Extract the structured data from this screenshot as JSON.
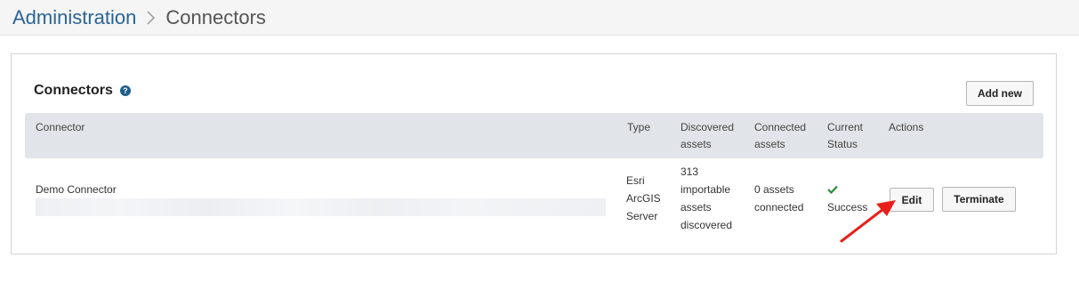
{
  "breadcrumb": {
    "parent": "Administration",
    "current": "Connectors"
  },
  "panel": {
    "title": "Connectors",
    "help_icon": "?",
    "add_button": "Add new"
  },
  "table": {
    "headers": {
      "connector": "Connector",
      "type": "Type",
      "discovered_1": "Discovered",
      "discovered_2": "assets",
      "connected_1": "Connected",
      "connected_2": "assets",
      "status_1": "Current",
      "status_2": "Status",
      "actions": "Actions"
    },
    "rows": [
      {
        "name": "Demo Connector",
        "type_1": "Esri",
        "type_2": "ArcGIS",
        "type_3": "Server",
        "discovered_1": "313",
        "discovered_2": "importable",
        "discovered_3": "assets",
        "discovered_4": "discovered",
        "connected_1": "0 assets",
        "connected_2": "connected",
        "status_icon": "checkmark-icon",
        "status": "Success",
        "edit_button": "Edit",
        "terminate_button": "Terminate"
      }
    ]
  },
  "colors": {
    "link": "#2a6496",
    "success": "#2e8b3a",
    "annotation_arrow": "#e8201b",
    "header_bg": "#e1e4e8"
  }
}
